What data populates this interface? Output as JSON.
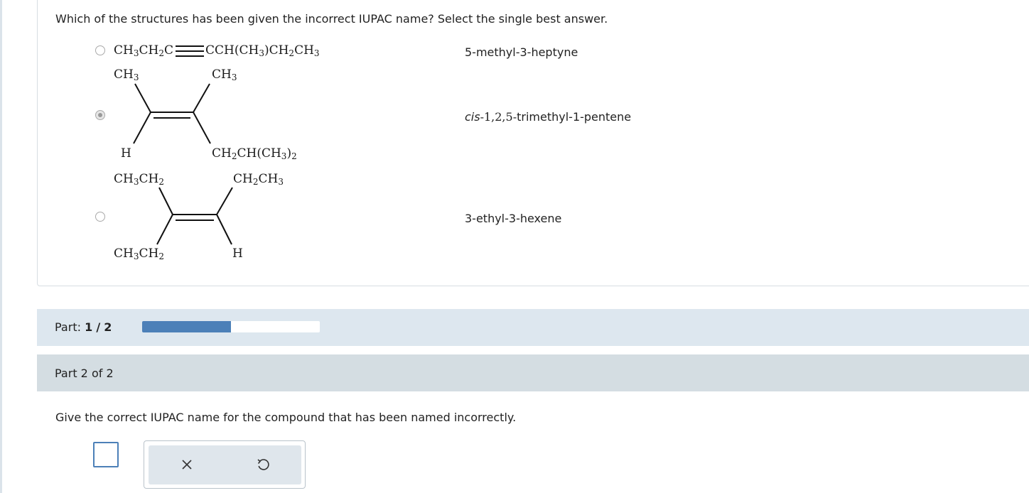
{
  "question": {
    "text": "Which of the structures has been given the incorrect IUPAC name? Select the single best answer."
  },
  "options": [
    {
      "selected": false,
      "structure": {
        "formula_part_a": "CH",
        "formula_part_a_sub": "3",
        "formula_part_b": "CH",
        "formula_part_b_sub": "2",
        "formula_part_c": "C",
        "formula_part_d": "CCH(CH",
        "formula_part_d_sub": "3",
        "formula_part_e": ")CH",
        "formula_part_e_sub": "2",
        "formula_part_f": "CH",
        "formula_part_f_sub": "3"
      },
      "name": "5-methyl-3-heptyne"
    },
    {
      "selected": true,
      "structure": {
        "top_left": "CH",
        "top_left_sub": "3",
        "top_right": "CH",
        "top_right_sub": "3",
        "bottom_left": "H",
        "bottom_right_a": "CH",
        "bottom_right_a_sub": "2",
        "bottom_right_b": "CH(CH",
        "bottom_right_b_sub": "3",
        "bottom_right_c": ")",
        "bottom_right_c_sub": "2"
      },
      "name_prefix": "cis",
      "name_nums": "-1,2,5-",
      "name_rest": "trimethyl-1-pentene"
    },
    {
      "selected": false,
      "structure": {
        "top_left_a": "CH",
        "top_left_a_sub": "3",
        "top_left_b": "CH",
        "top_left_b_sub": "2",
        "top_right_a": "CH",
        "top_right_a_sub": "2",
        "top_right_b": "CH",
        "top_right_b_sub": "3",
        "bottom_left_a": "CH",
        "bottom_left_a_sub": "3",
        "bottom_left_b": "CH",
        "bottom_left_b_sub": "2",
        "bottom_right": "H"
      },
      "name": "3-ethyl-3-hexene"
    }
  ],
  "progress": {
    "label": "Part:",
    "current": "1",
    "separator": "/",
    "total": "2",
    "fill_fraction": 0.5,
    "fill_color": "#4c80b8"
  },
  "part2": {
    "title": "Part 2 of 2",
    "instruction": "Give the correct IUPAC name for the compound that has been named incorrectly."
  },
  "tools": [
    {
      "icon": "close-icon",
      "glyph": "×"
    },
    {
      "icon": "undo-icon",
      "glyph": "↺"
    }
  ],
  "colors": {
    "accent": "#4c80b8",
    "progress_row_bg": "#dde7ef",
    "part_header_bg": "#d4dde2",
    "success_green": "#3f9a3b"
  }
}
